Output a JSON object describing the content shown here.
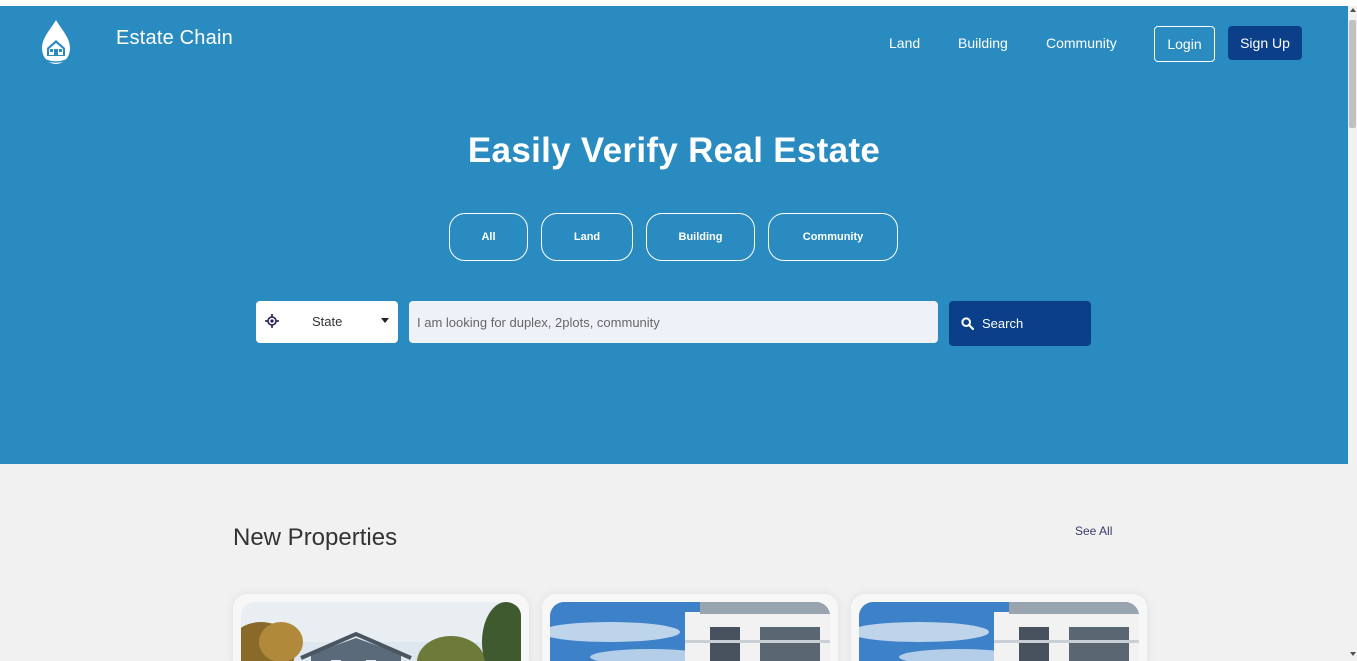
{
  "header": {
    "brand": "Estate Chain",
    "logo_icon": "house-drop-logo",
    "nav": [
      {
        "label": "Land"
      },
      {
        "label": "Building"
      },
      {
        "label": "Community"
      }
    ],
    "login_label": "Login",
    "signup_label": "Sign Up"
  },
  "hero": {
    "headline": "Easily Verify Real Estate",
    "filters": [
      {
        "label": "All"
      },
      {
        "label": "Land"
      },
      {
        "label": "Building"
      },
      {
        "label": "Community"
      }
    ],
    "state_select": {
      "label": "State",
      "icon": "location-target-icon"
    },
    "search": {
      "placeholder": "I am looking for duplex, 2plots, community",
      "button_label": "Search",
      "button_icon": "search-icon"
    }
  },
  "properties": {
    "title": "New Properties",
    "see_all": "See All",
    "cards": [
      {
        "image": "house-photo"
      },
      {
        "image": "building-photo"
      },
      {
        "image": "building-photo"
      }
    ]
  },
  "colors": {
    "hero_bg": "#2a8bc0",
    "primary_dark": "#0b3f8a",
    "section_bg": "#f1f1f1"
  }
}
